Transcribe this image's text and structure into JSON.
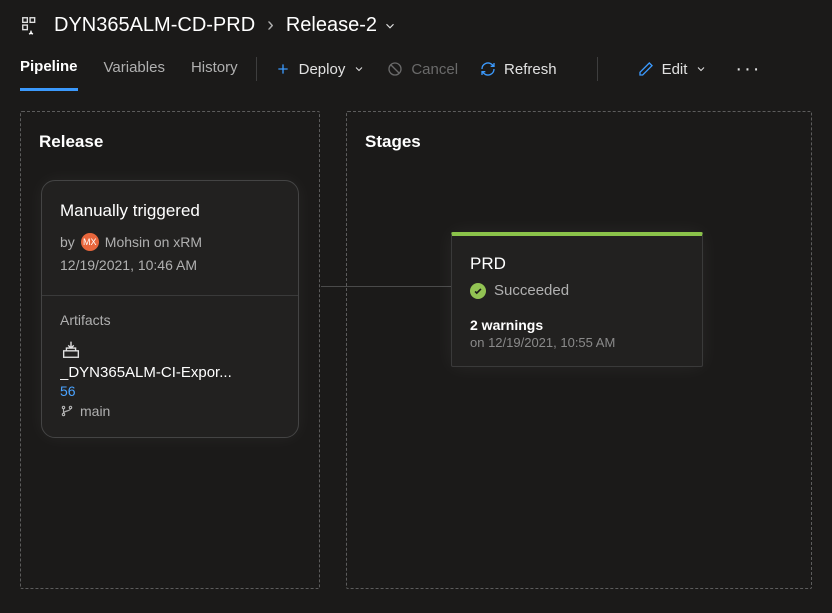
{
  "breadcrumb": {
    "pipeline": "DYN365ALM-CD-PRD",
    "release": "Release-2"
  },
  "tabs": [
    "Pipeline",
    "Variables",
    "History"
  ],
  "activeTab": "Pipeline",
  "actions": {
    "deploy": "Deploy",
    "cancel": "Cancel",
    "refresh": "Refresh",
    "edit": "Edit"
  },
  "panels": {
    "release_title": "Release",
    "stages_title": "Stages"
  },
  "release_card": {
    "trigger": "Manually triggered",
    "by_prefix": "by",
    "user": "Mohsin on xRM",
    "avatar_initials": "MX",
    "timestamp": "12/19/2021, 10:46 AM",
    "artifacts_label": "Artifacts",
    "artifact": {
      "name": "_DYN365ALM-CI-Expor...",
      "build": "56",
      "branch": "main"
    }
  },
  "stage_card": {
    "name": "PRD",
    "status": "Succeeded",
    "warnings": "2 warnings",
    "timestamp": "on 12/19/2021, 10:55 AM"
  }
}
